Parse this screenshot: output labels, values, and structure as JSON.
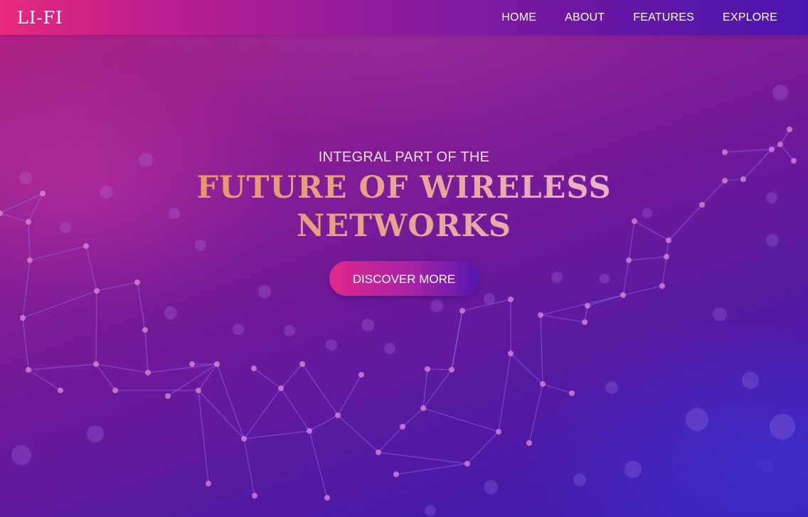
{
  "brand": {
    "logo": "LI-FI"
  },
  "nav": {
    "items": [
      {
        "label": "HOME"
      },
      {
        "label": "ABOUT"
      },
      {
        "label": "FEATURES"
      },
      {
        "label": "EXPLORE"
      }
    ]
  },
  "hero": {
    "eyebrow": "INTEGRAL PART OF THE",
    "headline_line1": "FUTURE OF WIRELESS",
    "headline_line2": "NETWORKS",
    "cta_label": "DISCOVER MORE"
  },
  "colors": {
    "nav_gradient_start": "#e7297e",
    "nav_gradient_end": "#4a16b0",
    "headline_gradient_start": "#e9894a",
    "headline_gradient_end": "#ecd3ee",
    "cta_gradient_start": "#e0288a",
    "cta_gradient_end": "#5417b2",
    "network_line": "#8a6cf0",
    "network_node": "#e08ad6"
  }
}
